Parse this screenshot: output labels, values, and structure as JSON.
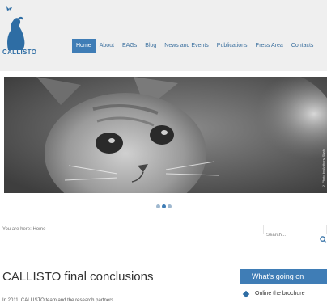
{
  "brand": {
    "name": "CALLISTO"
  },
  "colors": {
    "accent": "#3f7db6",
    "header_bg": "#efefef"
  },
  "nav": {
    "items": [
      {
        "label": "Home",
        "active": true
      },
      {
        "label": "About",
        "active": false
      },
      {
        "label": "EAGs",
        "active": false
      },
      {
        "label": "Blog",
        "active": false
      },
      {
        "label": "News and Events",
        "active": false
      },
      {
        "label": "Publications",
        "active": false
      },
      {
        "label": "Press Area",
        "active": false
      },
      {
        "label": "Contacts",
        "active": false
      }
    ]
  },
  "hero": {
    "photo_credit": "© Photo by Anthony Shah",
    "slides": 3,
    "active_slide": 1
  },
  "breadcrumb": {
    "text": "You are here: Home"
  },
  "search": {
    "placeholder": "Search...",
    "icon": "search-icon"
  },
  "main": {
    "title": "CALLISTO final conclusions",
    "intro": "In 2011, CALLISTO team and the research partners..."
  },
  "sidebar": {
    "header": "What's going on",
    "items": [
      "Online the brochure"
    ]
  }
}
